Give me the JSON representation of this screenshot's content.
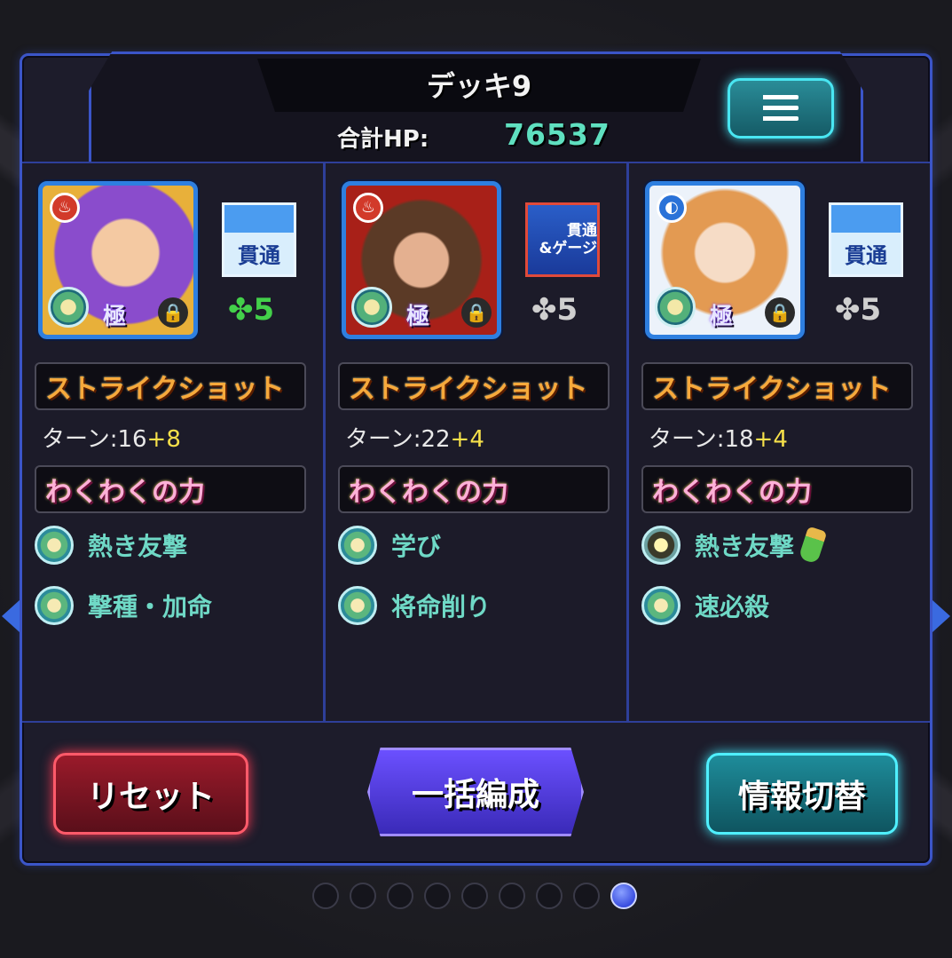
{
  "deck": {
    "title": "デッキ9",
    "hp_label": "合計HP:",
    "hp_value": "76537"
  },
  "menu_icon": "list-menu-icon",
  "columns": [
    {
      "element": "fire",
      "element_glyph": "♨",
      "gimmick": "貫通",
      "luck": "5",
      "luck_color": "#43d04a",
      "rank": "極",
      "ss_label": "ストライクショット",
      "turn_label": "ターン:16",
      "turn_plus": "+8",
      "ww_label": "わくわくの力",
      "abilities": [
        "熱き友撃",
        "撃種・加命"
      ]
    },
    {
      "element": "fire",
      "element_glyph": "♨",
      "gimmick_line1": "貫通",
      "gimmick_line2": "&ゲージ",
      "luck": "5",
      "luck_color": "#cfcfcf",
      "rank": "極",
      "ss_label": "ストライクショット",
      "turn_label": "ターン:22",
      "turn_plus": "+4",
      "ww_label": "わくわくの力",
      "abilities": [
        "学び",
        "将命削り"
      ]
    },
    {
      "element": "water",
      "element_glyph": "◐",
      "gimmick": "貫通",
      "luck": "5",
      "luck_color": "#cfcfcf",
      "rank": "極",
      "ss_label": "ストライクショット",
      "turn_label": "ターン:18",
      "turn_plus": "+4",
      "ww_label": "わくわくの力",
      "abilities": [
        "熱き友撃",
        "速必殺"
      ]
    }
  ],
  "buttons": {
    "reset": "リセット",
    "bulk": "一括編成",
    "info": "情報切替"
  },
  "pagination": {
    "total": 9,
    "current": 9
  },
  "clover": "✤",
  "lock_glyph": "🔒"
}
